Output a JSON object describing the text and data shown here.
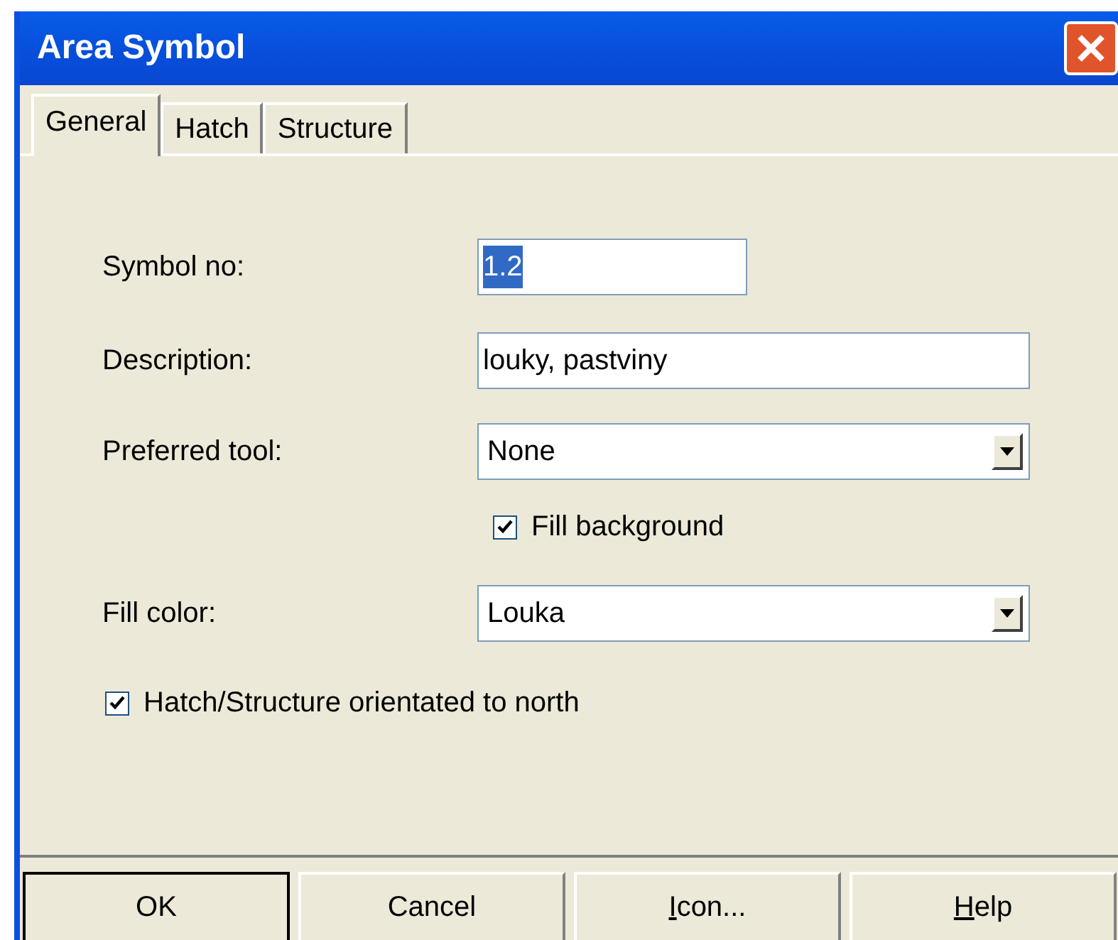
{
  "window": {
    "title": "Area Symbol"
  },
  "tabs": [
    {
      "label": "General",
      "selected": true
    },
    {
      "label": "Hatch",
      "selected": false
    },
    {
      "label": "Structure",
      "selected": false
    }
  ],
  "form": [
    {
      "kind": "text",
      "label": "Symbol no:",
      "value": "1.2",
      "value_selected": true
    },
    {
      "kind": "text",
      "label": "Description:",
      "value": "louky, pastviny",
      "value_selected": false
    },
    {
      "kind": "dropdown",
      "label": "Preferred tool:",
      "value": "None"
    },
    {
      "kind": "checkbox",
      "label": "Fill background",
      "checked": true
    },
    {
      "kind": "dropdown",
      "label": "Fill color:",
      "value": "Louka"
    },
    {
      "kind": "wide-checkbox",
      "label": "Hatch/Structure orientated to north",
      "checked": true
    }
  ],
  "buttons": [
    {
      "label": "OK",
      "default": true,
      "underline_first": false
    },
    {
      "label": "Cancel",
      "default": false,
      "underline_first": false
    },
    {
      "label": "Icon...",
      "default": false,
      "underline_first": true
    },
    {
      "label": "Help",
      "default": false,
      "underline_first": true
    }
  ]
}
